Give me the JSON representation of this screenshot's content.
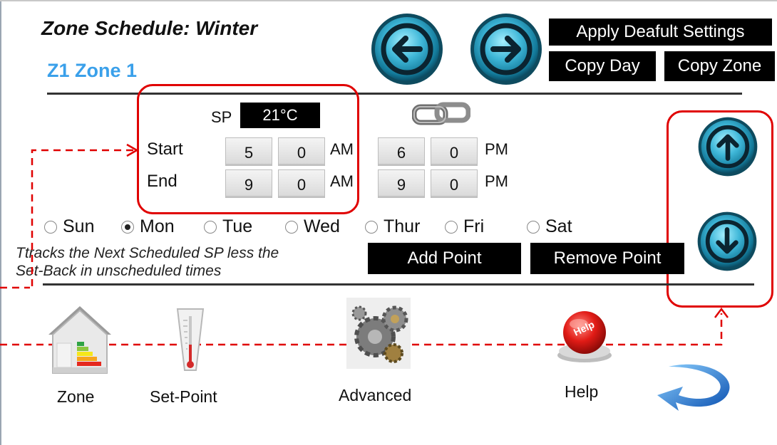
{
  "header": {
    "title": "Zone Schedule: Winter",
    "zone": "Z1 Zone 1"
  },
  "toolbar": {
    "apply_default": "Apply Deafult Settings",
    "copy_day": "Copy Day",
    "copy_zone": "Copy Zone",
    "prev_icon": "left-arrow-icon",
    "next_icon": "right-arrow-icon"
  },
  "setpoint": {
    "label": "SP",
    "value": "21°C",
    "link_icon": "chain-link-icon"
  },
  "schedule": {
    "start_label": "Start",
    "end_label": "End",
    "period1": {
      "start_hour": "5",
      "start_min": "0",
      "start_ampm": "AM",
      "end_hour": "9",
      "end_min": "0",
      "end_ampm": "AM"
    },
    "period2": {
      "start_hour": "6",
      "start_min": "0",
      "start_ampm": "PM",
      "end_hour": "9",
      "end_min": "0",
      "end_ampm": "PM"
    }
  },
  "days": [
    {
      "label": "Sun",
      "selected": false
    },
    {
      "label": "Mon",
      "selected": true
    },
    {
      "label": "Tue",
      "selected": false
    },
    {
      "label": "Wed",
      "selected": false
    },
    {
      "label": "Thur",
      "selected": false
    },
    {
      "label": "Fri",
      "selected": false
    },
    {
      "label": "Sat",
      "selected": false
    }
  ],
  "note": {
    "line1": "Ttracks the Next Scheduled SP less the",
    "line2": "Set-Back in unscheduled times"
  },
  "actions": {
    "add_point": "Add Point",
    "remove_point": "Remove Point"
  },
  "bottom_nav": {
    "zone": "Zone",
    "setpoint": "Set-Point",
    "advanced": "Advanced",
    "help": "Help",
    "help_badge": "Help"
  },
  "colors": {
    "accent_blue": "#3aa0ea",
    "annotation_red": "#e00000",
    "button_black": "#000000"
  }
}
